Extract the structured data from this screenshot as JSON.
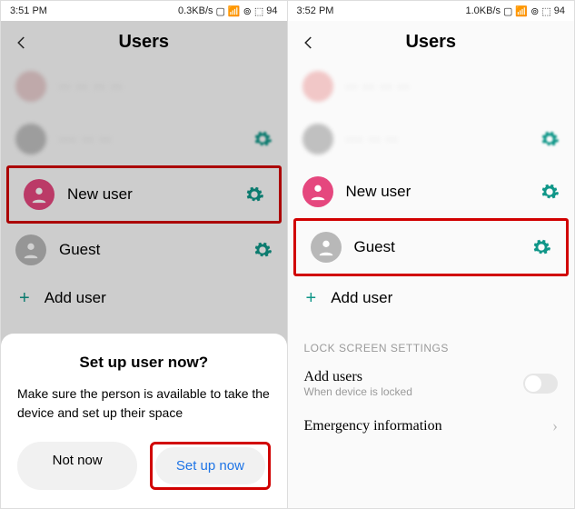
{
  "left": {
    "status": {
      "time": "3:51 PM",
      "net": "0.3KB/s",
      "battery": "94"
    },
    "header": {
      "title": "Users"
    },
    "blurRow1": {
      "label": "·· ·· ·· ··"
    },
    "blurRow2": {
      "label": "··· ·· ··"
    },
    "newUser": {
      "label": "New user"
    },
    "guest": {
      "label": "Guest"
    },
    "addUser": {
      "label": "Add user"
    },
    "sheet": {
      "title": "Set up user now?",
      "body": "Make sure the person is available to take the device and set up their space",
      "notNow": "Not now",
      "setUp": "Set up now"
    }
  },
  "right": {
    "status": {
      "time": "3:52 PM",
      "net": "1.0KB/s",
      "battery": "94"
    },
    "header": {
      "title": "Users"
    },
    "blurRow1": {
      "label": "·· ·· ·· ··"
    },
    "blurRow2": {
      "label": "··· ·· ··"
    },
    "newUser": {
      "label": "New user"
    },
    "guest": {
      "label": "Guest"
    },
    "addUser": {
      "label": "Add user"
    },
    "sectionLabel": "LOCK SCREEN SETTINGS",
    "addUsers": {
      "main": "Add users",
      "sub": "When device is locked"
    },
    "emergency": {
      "main": "Emergency information"
    }
  }
}
